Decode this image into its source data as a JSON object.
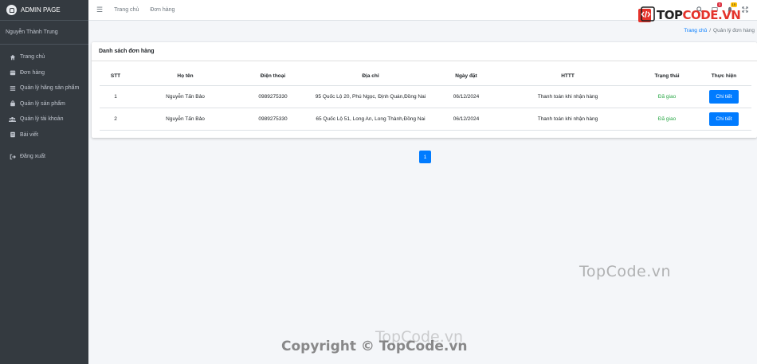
{
  "sidebar": {
    "brand": "ADMIN PAGE",
    "user": "Nguyễn Thành Trung",
    "items": [
      {
        "label": "Trang chủ",
        "icon": "home-icon"
      },
      {
        "label": "Đơn hàng",
        "icon": "box-icon"
      },
      {
        "label": "Quản lý hãng sản phẩm",
        "icon": "list-icon"
      },
      {
        "label": "Quản lý sản phẩm",
        "icon": "bag-icon"
      },
      {
        "label": "Quản lý tài khoản",
        "icon": "users-icon"
      },
      {
        "label": "Bài viết",
        "icon": "doc-icon"
      },
      {
        "label": "Đăng xuất",
        "icon": "logout-icon"
      }
    ]
  },
  "topbar": {
    "links": [
      "Trang chủ",
      "Đơn hàng"
    ],
    "badges": {
      "messages": "3",
      "notifications": "15"
    }
  },
  "logo": {
    "part1": "TOP",
    "part2": "CODE.VN"
  },
  "breadcrumb": {
    "home": "Trang chủ",
    "current": "Quản lý đơn hàng"
  },
  "card": {
    "title": "Danh sách đơn hàng",
    "columns": [
      "STT",
      "Họ tên",
      "Điện thoại",
      "Địa chỉ",
      "Ngày đặt",
      "HTTT",
      "Trạng thái",
      "Thực hiện"
    ],
    "rows": [
      {
        "stt": "1",
        "name": "Nguyễn Tấn Bảo",
        "phone": "0989275330",
        "address": "95 Quốc Lộ 20, Phú Ngọc, Định Quán,Đồng Nai",
        "date": "06/12/2024",
        "payment": "Thanh toán khi nhận hàng",
        "status": "Đã giao",
        "action": "Chi tiết"
      },
      {
        "stt": "2",
        "name": "Nguyễn Tấn Bảo",
        "phone": "0989275330",
        "address": "65 Quốc Lộ 51, Long An, Long Thành,Đồng Nai",
        "date": "06/12/2024",
        "payment": "Thanh toán khi nhận hàng",
        "status": "Đã giao",
        "action": "Chi tiết"
      }
    ]
  },
  "pagination": {
    "current": "1"
  },
  "watermarks": {
    "w1": "TopCode.vn",
    "w2": "TopCode.vn",
    "w3": "Copyright © TopCode.vn"
  },
  "colors": {
    "sidebar": "#343a40",
    "primary": "#007bff",
    "success": "#28a745",
    "logo_red": "#e4332b"
  }
}
